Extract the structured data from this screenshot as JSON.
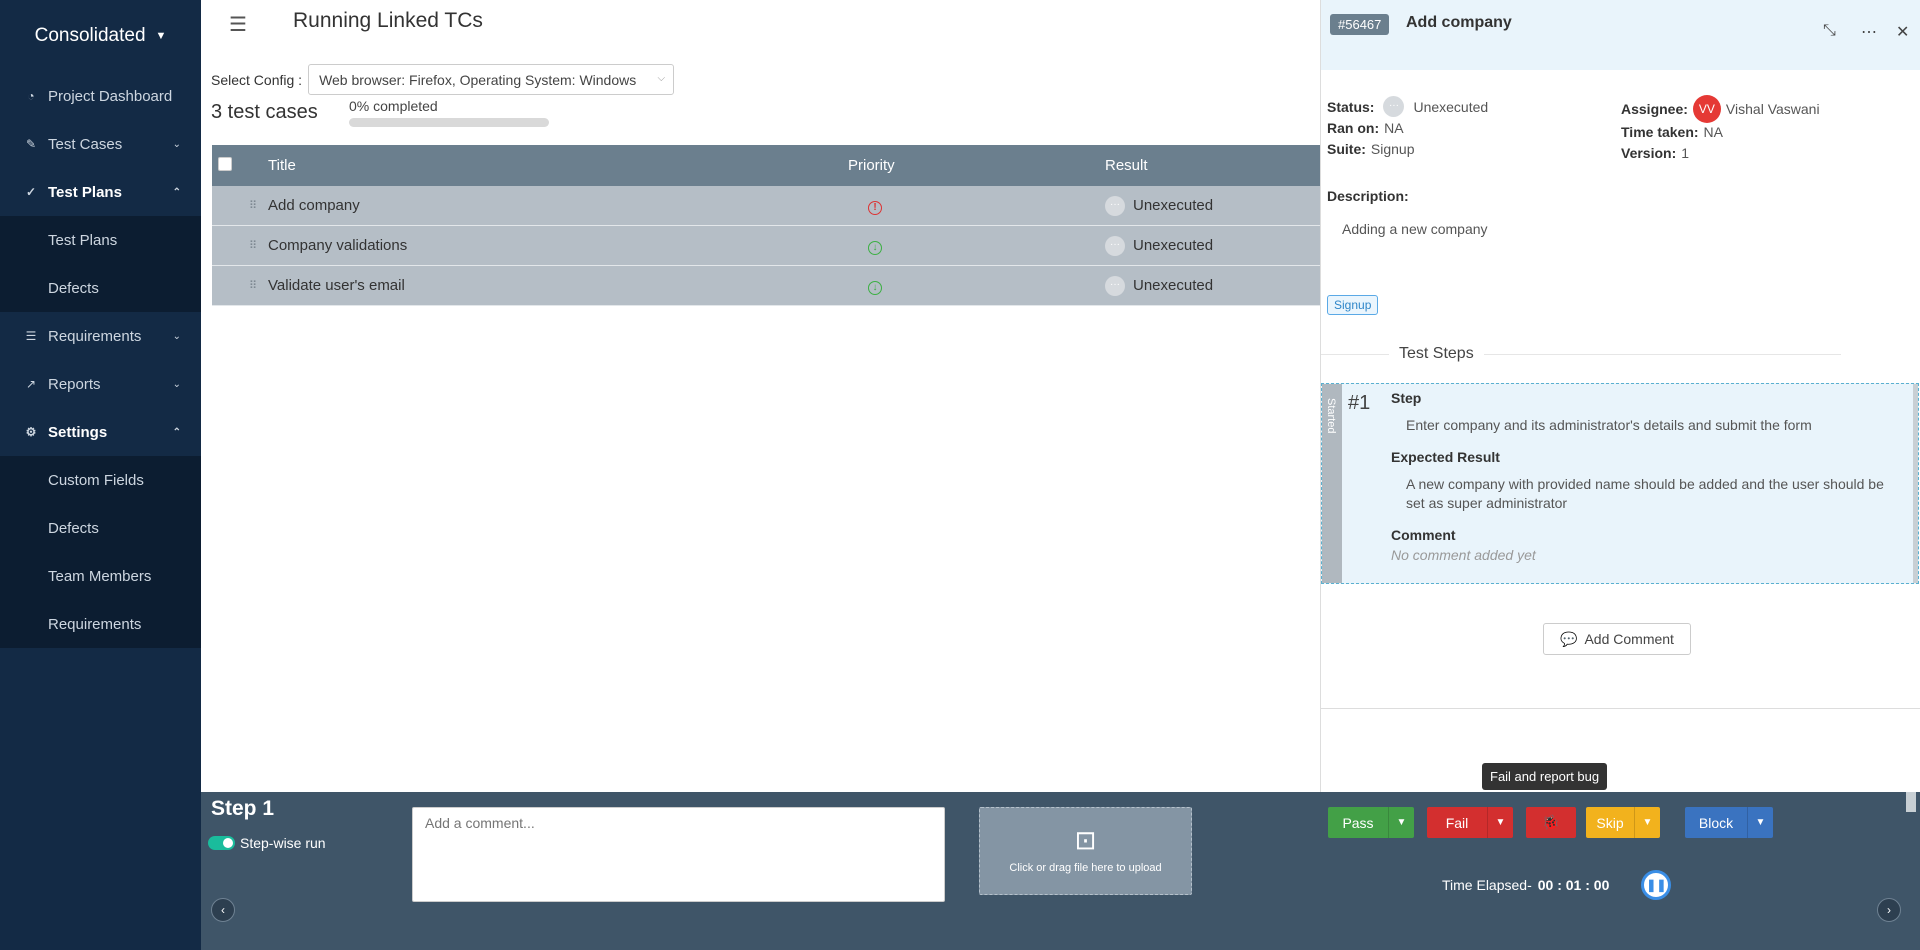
{
  "sidebar": {
    "brand": "Consolidated",
    "items": [
      {
        "label": "Project Dashboard",
        "icon": "dashboard-icon"
      },
      {
        "label": "Test Cases",
        "icon": "edit-icon"
      },
      {
        "label": "Test Plans",
        "icon": "check-circle-icon"
      },
      {
        "label": "Requirements",
        "icon": "list-icon"
      },
      {
        "label": "Reports",
        "icon": "chart-icon"
      },
      {
        "label": "Settings",
        "icon": "gear-icon"
      }
    ],
    "test_plans_sub": [
      "Test Plans",
      "Defects"
    ],
    "settings_sub": [
      "Custom Fields",
      "Defects",
      "Team Members",
      "Requirements"
    ]
  },
  "main": {
    "title": "Running Linked TCs",
    "config_label": "Select Config :",
    "config_value": "Web browser: Firefox, Operating System: Windows",
    "count": "3 test cases",
    "progress_label": "0% completed",
    "progress_value": 0,
    "columns": {
      "title": "Title",
      "priority": "Priority",
      "result": "Result"
    },
    "rows": [
      {
        "title": "Add company",
        "priority": "high",
        "result": "Unexecuted"
      },
      {
        "title": "Company validations",
        "priority": "low",
        "result": "Unexecuted"
      },
      {
        "title": "Validate user's email",
        "priority": "low",
        "result": "Unexecuted"
      }
    ]
  },
  "panel": {
    "id": "#56467",
    "title": "Add company",
    "status_label": "Status:",
    "status_value": "Unexecuted",
    "ran_on_label": "Ran on:",
    "ran_on_value": "NA",
    "suite_label": "Suite:",
    "suite_value": "Signup",
    "assignee_label": "Assignee:",
    "assignee_initials": "VV",
    "assignee_name": "Vishal Vaswani",
    "time_taken_label": "Time taken:",
    "time_taken_value": "NA",
    "version_label": "Version:",
    "version_value": "1",
    "description_label": "Description:",
    "description_text": "Adding a new company",
    "tag": "Signup",
    "steps_title": "Test Steps",
    "step": {
      "side_label": "Started",
      "number": "#1",
      "step_label": "Step",
      "step_text": "Enter company and its administrator's details and submit the form",
      "expected_label": "Expected Result",
      "expected_text": "A new company with provided name should be added and the user should be set as super administrator",
      "comment_label": "Comment",
      "comment_text": "No comment added yet"
    },
    "add_comment": "Add Comment"
  },
  "bottom": {
    "step_label": "Step 1",
    "stepwise_label": "Step-wise run",
    "comment_placeholder": "Add a comment...",
    "upload_text": "Click or drag file here to upload",
    "pass": "Pass",
    "fail": "Fail",
    "skip": "Skip",
    "block": "Block",
    "tooltip": "Fail and report bug",
    "time_label": "Time Elapsed-",
    "time_value": "00 : 01 : 00"
  },
  "colors": {
    "sidebar": "#132a45",
    "table_header": "#6b7f8e",
    "pass": "#43a047",
    "fail": "#d32f2f",
    "skip": "#f2b21d",
    "block": "#3a73c0"
  }
}
